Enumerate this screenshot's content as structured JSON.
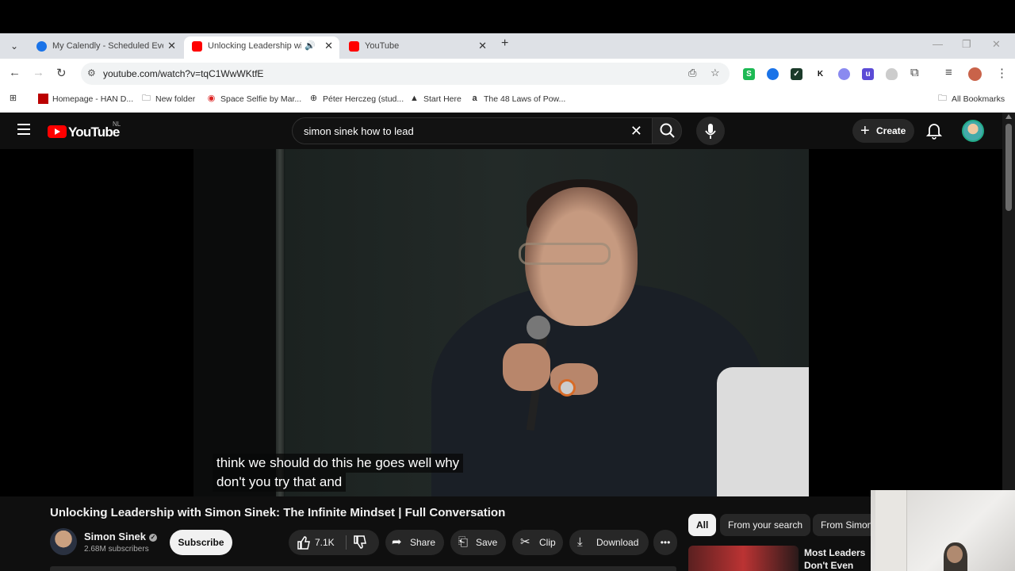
{
  "browser": {
    "tabs": [
      {
        "title": "My Calendly - Scheduled Events",
        "active": false,
        "favicon_color": "#006bff"
      },
      {
        "title": "Unlocking Leadership with Simon Sinek",
        "active": true,
        "favicon_color": "#ff0000",
        "audio": true
      },
      {
        "title": "YouTube",
        "active": false,
        "favicon_color": "#ff0000"
      }
    ],
    "url": "youtube.com/watch?v=tqC1WwWKtfE",
    "extensions": [
      {
        "label": "S",
        "color": "#1db954"
      },
      {
        "label": "",
        "color": "#1a73e8"
      },
      {
        "label": "✓",
        "color": "#1b3a2a"
      },
      {
        "label": "K",
        "color": "#ffffff"
      },
      {
        "label": "",
        "color": "#8a8af0"
      },
      {
        "label": "u",
        "color": "#5b4bd6"
      }
    ],
    "bookmarks": [
      {
        "label": "Homepage - HAN D...",
        "icon": "han-icon"
      },
      {
        "label": "New folder",
        "icon": "folder-icon"
      },
      {
        "label": "Space Selfie by Mar...",
        "icon": "space-selfie-icon"
      },
      {
        "label": "Péter Herczeg (stud...",
        "icon": "globe-icon"
      },
      {
        "label": "Start Here",
        "icon": "triangle-icon"
      },
      {
        "label": "The 48 Laws of Pow...",
        "icon": "amazon-icon"
      }
    ],
    "all_bookmarks_label": "All Bookmarks"
  },
  "youtube": {
    "logo_text": "YouTube",
    "region": "NL",
    "search_query": "simon sinek how to lead",
    "create_label": "Create",
    "subtitles": [
      "think we should do this he goes well why",
      "don't you try that and"
    ],
    "video_title": "Unlocking Leadership with Simon Sinek: The Infinite Mindset | Full Conversation",
    "channel": {
      "name": "Simon Sinek",
      "subscribers": "2.68M subscribers"
    },
    "subscribe_label": "Subscribe",
    "actions": {
      "likes": "7.1K",
      "share": "Share",
      "save": "Save",
      "clip": "Clip",
      "download": "Download"
    },
    "chips": [
      "All",
      "From your search",
      "From Simon"
    ],
    "recommendation": {
      "title": "Most Leaders Don't Even Know the Game They're In"
    }
  }
}
